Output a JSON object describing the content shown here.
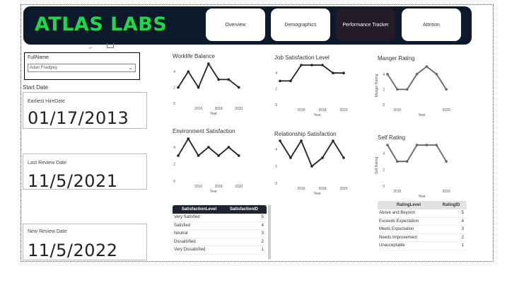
{
  "brand": {
    "title": "ATLAS LABS"
  },
  "tabs": [
    {
      "label": "Overview",
      "active": false
    },
    {
      "label": "Demographics",
      "active": false
    },
    {
      "label": "Performance Tracker",
      "active": true
    },
    {
      "label": "Attrition",
      "active": false
    }
  ],
  "slicer": {
    "label": "FullName",
    "value": "Adan Fradgley"
  },
  "start_date": {
    "title": "Start Date",
    "earliest_hire_label": "Earliest HireDate",
    "earliest_hire_value": "01/17/2013"
  },
  "review": {
    "last_label": "Last Review Date",
    "last_value": "11/5/2021",
    "new_label": "New Review Date",
    "new_value": "11/5/2022"
  },
  "chart_data": [
    {
      "type": "line",
      "title": "Worklife Balance",
      "xlabel": "Year",
      "ylabel": "",
      "x": [
        2014,
        2015,
        2016,
        2017,
        2018,
        2019,
        2020,
        2021
      ],
      "values": [
        2,
        4,
        2,
        5,
        3,
        3,
        2,
        null
      ],
      "xticks": [
        "2016",
        "2018",
        "2020"
      ],
      "yticks": [
        "0",
        "2",
        "4"
      ],
      "ylim": [
        0,
        5
      ],
      "color": "#222222"
    },
    {
      "type": "line",
      "title": "Job Satisfaction Level",
      "xlabel": "Year",
      "ylabel": "",
      "x": [
        2014,
        2015,
        2016,
        2017,
        2018,
        2019,
        2020,
        2021
      ],
      "values": [
        3,
        3,
        5,
        5,
        5,
        4,
        4,
        null
      ],
      "xticks": [
        "2016",
        "2018",
        "2020"
      ],
      "yticks": [
        "0",
        "2",
        "4"
      ],
      "ylim": [
        0,
        5
      ],
      "color": "#222222"
    },
    {
      "type": "line",
      "title": "Manger Rating",
      "xlabel": "Year",
      "ylabel": "Manger Rating",
      "x": [
        2014,
        2015,
        2016,
        2017,
        2018,
        2019,
        2020,
        2021
      ],
      "values": [
        4,
        2,
        2,
        4,
        5,
        4,
        2,
        null
      ],
      "xticks": [
        "2015",
        "2020"
      ],
      "yticks": [
        "0",
        "2",
        "4"
      ],
      "ylim": [
        0,
        5
      ],
      "color": "#666666"
    },
    {
      "type": "line",
      "title": "Environment Satisfaction",
      "xlabel": "Year",
      "ylabel": "",
      "x": [
        2014,
        2015,
        2016,
        2017,
        2018,
        2019,
        2020,
        2021
      ],
      "values": [
        3,
        5,
        3,
        4,
        3,
        4,
        3,
        null
      ],
      "xticks": [
        "2016",
        "2018",
        "2020"
      ],
      "yticks": [
        "0",
        "2",
        "4"
      ],
      "ylim": [
        0,
        5
      ],
      "color": "#222222"
    },
    {
      "type": "line",
      "title": "Relationship Satisfaction",
      "xlabel": "Year",
      "ylabel": "",
      "x": [
        2014,
        2015,
        2016,
        2017,
        2018,
        2019,
        2020,
        2021
      ],
      "values": [
        5,
        3,
        5,
        2,
        3,
        5,
        3,
        null
      ],
      "xticks": [
        "2016",
        "2018",
        "2020"
      ],
      "yticks": [
        "0",
        "2",
        "4"
      ],
      "ylim": [
        0,
        5
      ],
      "color": "#222222"
    },
    {
      "type": "line",
      "title": "Self Rating",
      "xlabel": "Year",
      "ylabel": "Self Rating",
      "x": [
        2014,
        2015,
        2016,
        2017,
        2018,
        2019,
        2020,
        2021
      ],
      "values": [
        5,
        3,
        3,
        5,
        5,
        5,
        3,
        null
      ],
      "xticks": [
        "2015",
        "2020"
      ],
      "yticks": [
        "0",
        "2",
        "4"
      ],
      "ylim": [
        0,
        5
      ],
      "color": "#666666"
    }
  ],
  "satisfaction_table": {
    "headers": [
      "SatisfactionLevel",
      "SatisfactionID"
    ],
    "rows": [
      [
        "Very Satisfied",
        "5"
      ],
      [
        "Satisfied",
        "4"
      ],
      [
        "Neutral",
        "3"
      ],
      [
        "Dissatisfied",
        "2"
      ],
      [
        "Very Dissatisfied",
        "1"
      ]
    ]
  },
  "rating_table": {
    "headers": [
      "RatingLevel",
      "RatingID"
    ],
    "rows": [
      [
        "Above and Beyond",
        "5"
      ],
      [
        "Exceeds Expectation",
        "4"
      ],
      [
        "Meets Expectation",
        "3"
      ],
      [
        "Needs Improvement",
        "2"
      ],
      [
        "Unacceptable",
        "1"
      ]
    ]
  },
  "colors": {
    "header_bg": "#0c1a2b",
    "brand": "#22d64a",
    "active_tab": "#231c28"
  }
}
